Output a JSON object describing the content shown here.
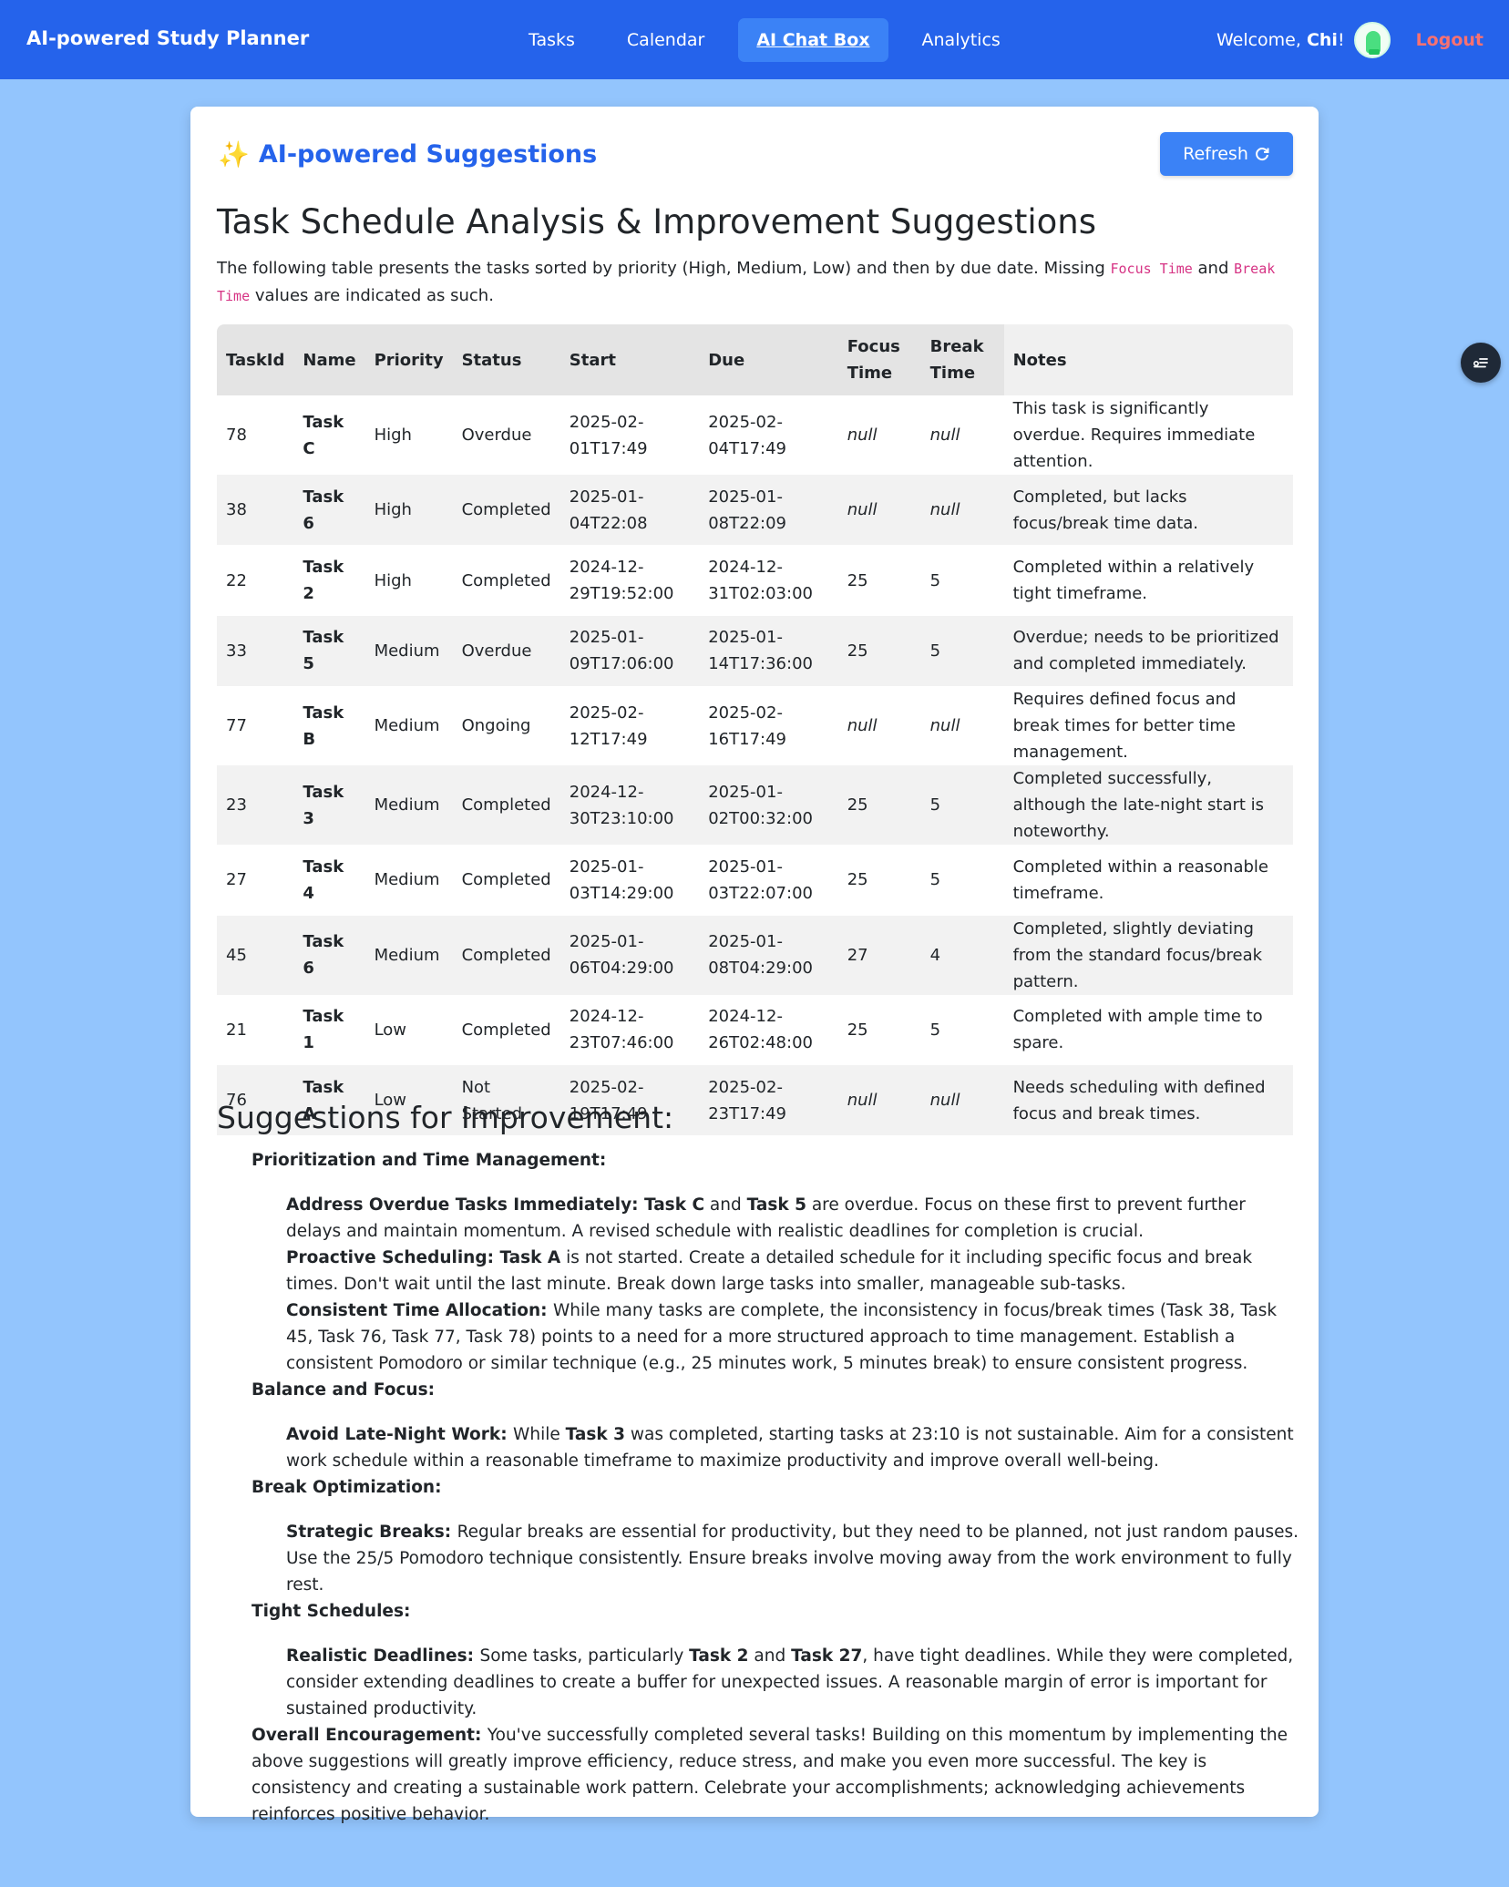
{
  "nav": {
    "brand": "AI-powered Study Planner",
    "links": [
      {
        "label": "Tasks",
        "active": false
      },
      {
        "label": "Calendar",
        "active": false
      },
      {
        "label": "AI Chat Box",
        "active": true
      },
      {
        "label": "Analytics",
        "active": false
      }
    ],
    "welcome_prefix": "Welcome, ",
    "user": "Chi",
    "welcome_suffix": "!",
    "logout": "Logout"
  },
  "card": {
    "title_icon": "sparkles-icon",
    "title": "AI-powered Suggestions",
    "refresh_label": "Refresh",
    "refresh_icon": "refresh-icon",
    "heading": "Task Schedule Analysis & Improvement Suggestions",
    "intro_part1": "The following table presents the tasks sorted by priority (High, Medium, Low) and then by due date. Missing ",
    "intro_code1": "Focus Time",
    "intro_part2": " and ",
    "intro_code2": "Break Time",
    "intro_part3": " values are indicated as such."
  },
  "table": {
    "headers": [
      "TaskId",
      "Name",
      "Priority",
      "Status",
      "Start",
      "Due",
      "Focus Time",
      "Break Time",
      "Notes"
    ],
    "rows": [
      {
        "id": "78",
        "name": "Task C",
        "priority": "High",
        "status": "Overdue",
        "start": "2025-02-01T17:49",
        "due": "2025-02-04T17:49",
        "focus": "null",
        "break": "null",
        "notes": "This task is significantly overdue. Requires immediate attention."
      },
      {
        "id": "38",
        "name": "Task 6",
        "priority": "High",
        "status": "Completed",
        "start": "2025-01-04T22:08",
        "due": "2025-01-08T22:09",
        "focus": "null",
        "break": "null",
        "notes": "Completed, but lacks focus/break time data."
      },
      {
        "id": "22",
        "name": "Task 2",
        "priority": "High",
        "status": "Completed",
        "start": "2024-12-29T19:52:00",
        "due": "2024-12-31T02:03:00",
        "focus": "25",
        "break": "5",
        "notes": "Completed within a relatively tight timeframe."
      },
      {
        "id": "33",
        "name": "Task 5",
        "priority": "Medium",
        "status": "Overdue",
        "start": "2025-01-09T17:06:00",
        "due": "2025-01-14T17:36:00",
        "focus": "25",
        "break": "5",
        "notes": "Overdue; needs to be prioritized and completed immediately."
      },
      {
        "id": "77",
        "name": "Task B",
        "priority": "Medium",
        "status": "Ongoing",
        "start": "2025-02-12T17:49",
        "due": "2025-02-16T17:49",
        "focus": "null",
        "break": "null",
        "notes": "Requires defined focus and break times for better time management."
      },
      {
        "id": "23",
        "name": "Task 3",
        "priority": "Medium",
        "status": "Completed",
        "start": "2024-12-30T23:10:00",
        "due": "2025-01-02T00:32:00",
        "focus": "25",
        "break": "5",
        "notes": "Completed successfully, although the late-night start is noteworthy."
      },
      {
        "id": "27",
        "name": "Task 4",
        "priority": "Medium",
        "status": "Completed",
        "start": "2025-01-03T14:29:00",
        "due": "2025-01-03T22:07:00",
        "focus": "25",
        "break": "5",
        "notes": "Completed within a reasonable timeframe."
      },
      {
        "id": "45",
        "name": "Task 6",
        "priority": "Medium",
        "status": "Completed",
        "start": "2025-01-06T04:29:00",
        "due": "2025-01-08T04:29:00",
        "focus": "27",
        "break": "4",
        "notes": "Completed, slightly deviating from the standard focus/break pattern."
      },
      {
        "id": "21",
        "name": "Task 1",
        "priority": "Low",
        "status": "Completed",
        "start": "2024-12-23T07:46:00",
        "due": "2024-12-26T02:48:00",
        "focus": "25",
        "break": "5",
        "notes": "Completed with ample time to spare."
      },
      {
        "id": "76",
        "name": "Task A",
        "priority": "Low",
        "status": "Not Started",
        "start": "2025-02-19T17:49",
        "due": "2025-02-23T17:49",
        "focus": "null",
        "break": "null",
        "notes": "Needs scheduling with defined focus and break times."
      }
    ]
  },
  "suggestions": {
    "heading": "Suggestions for Improvement:",
    "sections": [
      {
        "title": "Prioritization and Time Management:",
        "items": [
          [
            {
              "b": "Address Overdue Tasks Immediately: "
            },
            {
              "b": "Task C"
            },
            {
              "t": " and "
            },
            {
              "b": "Task 5"
            },
            {
              "t": " are overdue. Focus on these first to prevent further delays and maintain momentum. A revised schedule with realistic deadlines for completion is crucial."
            }
          ],
          [
            {
              "b": "Proactive Scheduling: "
            },
            {
              "b": "Task A"
            },
            {
              "t": " is not started. Create a detailed schedule for it including specific focus and break times. Don't wait until the last minute. Break down large tasks into smaller, manageable sub-tasks."
            }
          ],
          [
            {
              "b": "Consistent Time Allocation: "
            },
            {
              "t": "While many tasks are complete, the inconsistency in focus/break times (Task 38, Task 45, Task 76, Task 77, Task 78) points to a need for a more structured approach to time management. Establish a consistent Pomodoro or similar technique (e.g., 25 minutes work, 5 minutes break) to ensure consistent progress."
            }
          ]
        ]
      },
      {
        "title": "Balance and Focus:",
        "items": [
          [
            {
              "b": "Avoid Late-Night Work: "
            },
            {
              "t": "While "
            },
            {
              "b": "Task 3"
            },
            {
              "t": " was completed, starting tasks at 23:10 is not sustainable. Aim for a consistent work schedule within a reasonable timeframe to maximize productivity and improve overall well-being."
            }
          ]
        ]
      },
      {
        "title": "Break Optimization:",
        "items": [
          [
            {
              "b": "Strategic Breaks: "
            },
            {
              "t": "Regular breaks are essential for productivity, but they need to be planned, not just random pauses. Use the 25/5 Pomodoro technique consistently. Ensure breaks involve moving away from the work environment to fully rest."
            }
          ]
        ]
      },
      {
        "title": "Tight Schedules:",
        "items": [
          [
            {
              "b": "Realistic Deadlines: "
            },
            {
              "t": "Some tasks, particularly "
            },
            {
              "b": "Task 2"
            },
            {
              "t": " and "
            },
            {
              "b": "Task 27"
            },
            {
              "t": ", have tight deadlines. While they were completed, consider extending deadlines to create a buffer for unexpected issues. A reasonable margin of error is important for sustained productivity."
            }
          ]
        ]
      }
    ],
    "encouragement": [
      {
        "b": "Overall Encouragement: "
      },
      {
        "t": "You've successfully completed several tasks! Building on this momentum by implementing the above suggestions will greatly improve efficiency, reduce stress, and make you even more successful. The key is consistency and creating a sustainable work pattern. Celebrate your accomplishments; acknowledging achievements reinforces positive behavior."
      }
    ]
  }
}
